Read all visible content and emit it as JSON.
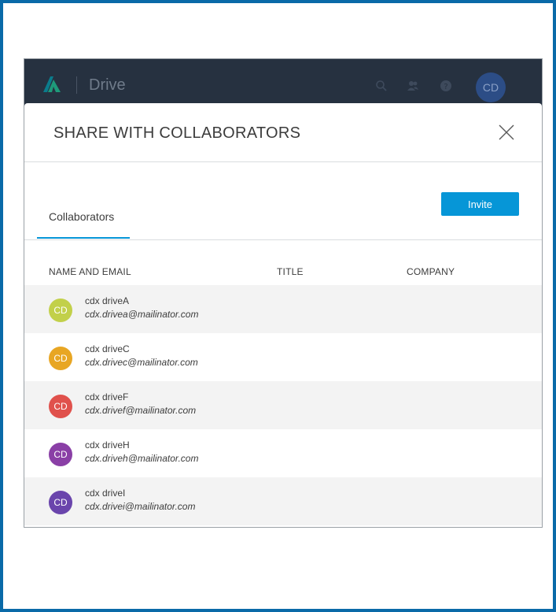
{
  "app": {
    "product_name": "Drive",
    "user_initials": "CD"
  },
  "modal": {
    "title": "SHARE WITH COLLABORATORS",
    "invite_label": "Invite",
    "tab_label": "Collaborators"
  },
  "table": {
    "columns": [
      "NAME AND EMAIL",
      "TITLE",
      "COMPANY"
    ],
    "rows": [
      {
        "initials": "CD",
        "name": "cdx driveA",
        "email": "cdx.drivea@mailinator.com",
        "color": "#c2d04a"
      },
      {
        "initials": "CD",
        "name": "cdx driveC",
        "email": "cdx.drivec@mailinator.com",
        "color": "#e8a623"
      },
      {
        "initials": "CD",
        "name": "cdx driveF",
        "email": "cdx.drivef@mailinator.com",
        "color": "#e0514c"
      },
      {
        "initials": "CD",
        "name": "cdx driveH",
        "email": "cdx.driveh@mailinator.com",
        "color": "#8a3fa6"
      },
      {
        "initials": "CD",
        "name": "cdx driveI",
        "email": "cdx.drivei@mailinator.com",
        "color": "#6a45ac"
      }
    ]
  },
  "colors": {
    "frame_border": "#0a6aa8",
    "topbar": "#263140",
    "accent": "#0696d7"
  },
  "icons": [
    "autodesk-logo-icon",
    "search-icon",
    "users-icon",
    "help-icon",
    "close-icon"
  ]
}
